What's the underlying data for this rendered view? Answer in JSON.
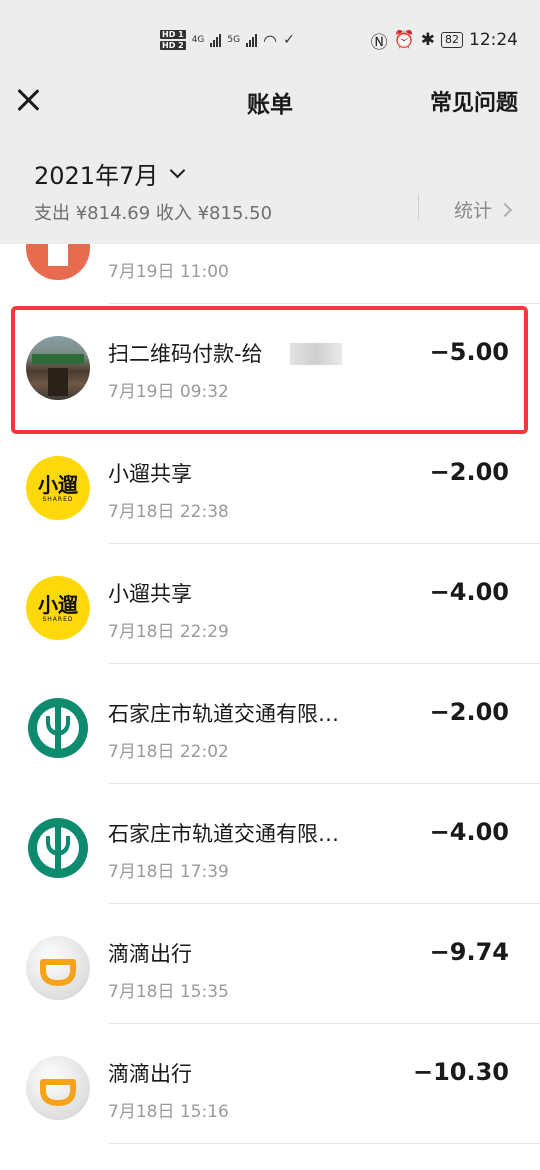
{
  "status_bar": {
    "hd1": "HD 1",
    "hd2": "HD 2",
    "net1": "4G",
    "net2": "5G",
    "battery": "82",
    "time": "12:24"
  },
  "nav": {
    "title": "账单",
    "faq": "常见问题"
  },
  "summary": {
    "month": "2021年7月",
    "totals": "支出 ¥814.69 收入 ¥815.50",
    "stats": "统计"
  },
  "transactions": [
    {
      "name": "",
      "time": "7月19日 11:00",
      "amount": "",
      "icon": "partial-red-icon"
    },
    {
      "name": "扫二维码付款-给",
      "time": "7月19日 09:32",
      "amount": "−5.00",
      "icon": "merchant-photo-avatar"
    },
    {
      "name": "小遛共享",
      "time": "7月18日 22:38",
      "amount": "−2.00",
      "icon": "xiaoliu-logo"
    },
    {
      "name": "小遛共享",
      "time": "7月18日 22:29",
      "amount": "−4.00",
      "icon": "xiaoliu-logo"
    },
    {
      "name": "石家庄市轨道交通有限…",
      "time": "7月18日 22:02",
      "amount": "−2.00",
      "icon": "abc-bank-logo"
    },
    {
      "name": "石家庄市轨道交通有限…",
      "time": "7月18日 17:39",
      "amount": "−4.00",
      "icon": "abc-bank-logo"
    },
    {
      "name": "滴滴出行",
      "time": "7月18日 15:35",
      "amount": "−9.74",
      "icon": "didi-logo"
    },
    {
      "name": "滴滴出行",
      "time": "7月18日 15:16",
      "amount": "−10.30",
      "icon": "didi-logo"
    }
  ],
  "logo_text": {
    "xiaoliu_cn": "小遛",
    "xiaoliu_en": "SHARED"
  },
  "colors": {
    "highlight": "#f2383d",
    "xiaoliu": "#ffd80a",
    "abc_green": "#0e8a6e",
    "didi_orange": "#f7a21b"
  }
}
